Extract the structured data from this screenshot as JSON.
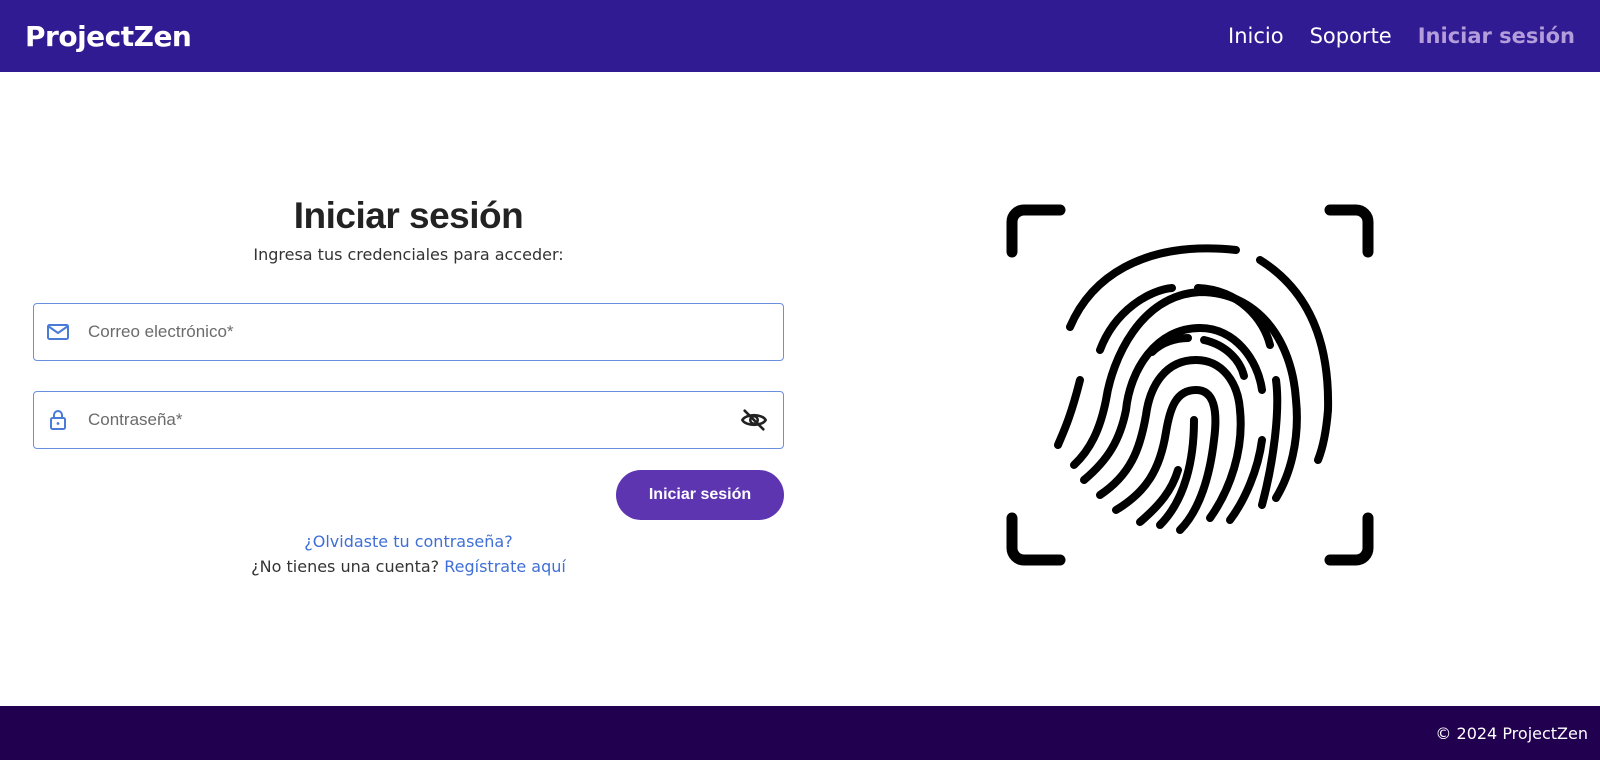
{
  "navbar": {
    "brand": "ProjectZen",
    "links": [
      {
        "label": "Inicio"
      },
      {
        "label": "Soporte"
      },
      {
        "label": "Iniciar sesión"
      }
    ],
    "active_color": "#b39ddb",
    "background": "#311b92"
  },
  "login": {
    "title": "Iniciar sesión",
    "subtitle": "Ingresa tus credenciales para acceder:",
    "email": {
      "placeholder": "Correo electrónico*",
      "value": "",
      "icon": "mail-icon"
    },
    "password": {
      "placeholder": "Contraseña*",
      "value": "",
      "icon": "lock-icon",
      "toggle_icon": "eye-off-icon"
    },
    "submit_label": "Iniciar sesión",
    "forgot_link": "¿Olvidaste tu contraseña?",
    "no_account_text": "¿No tienes una cuenta?",
    "register_link": "Regístrate aquí",
    "accent_color": "#5e35b1",
    "link_color": "#3f6fd6"
  },
  "illustration": {
    "icon": "fingerprint-scan-icon"
  },
  "footer": {
    "text": "© 2024 ProjectZen",
    "background": "#21004f"
  }
}
